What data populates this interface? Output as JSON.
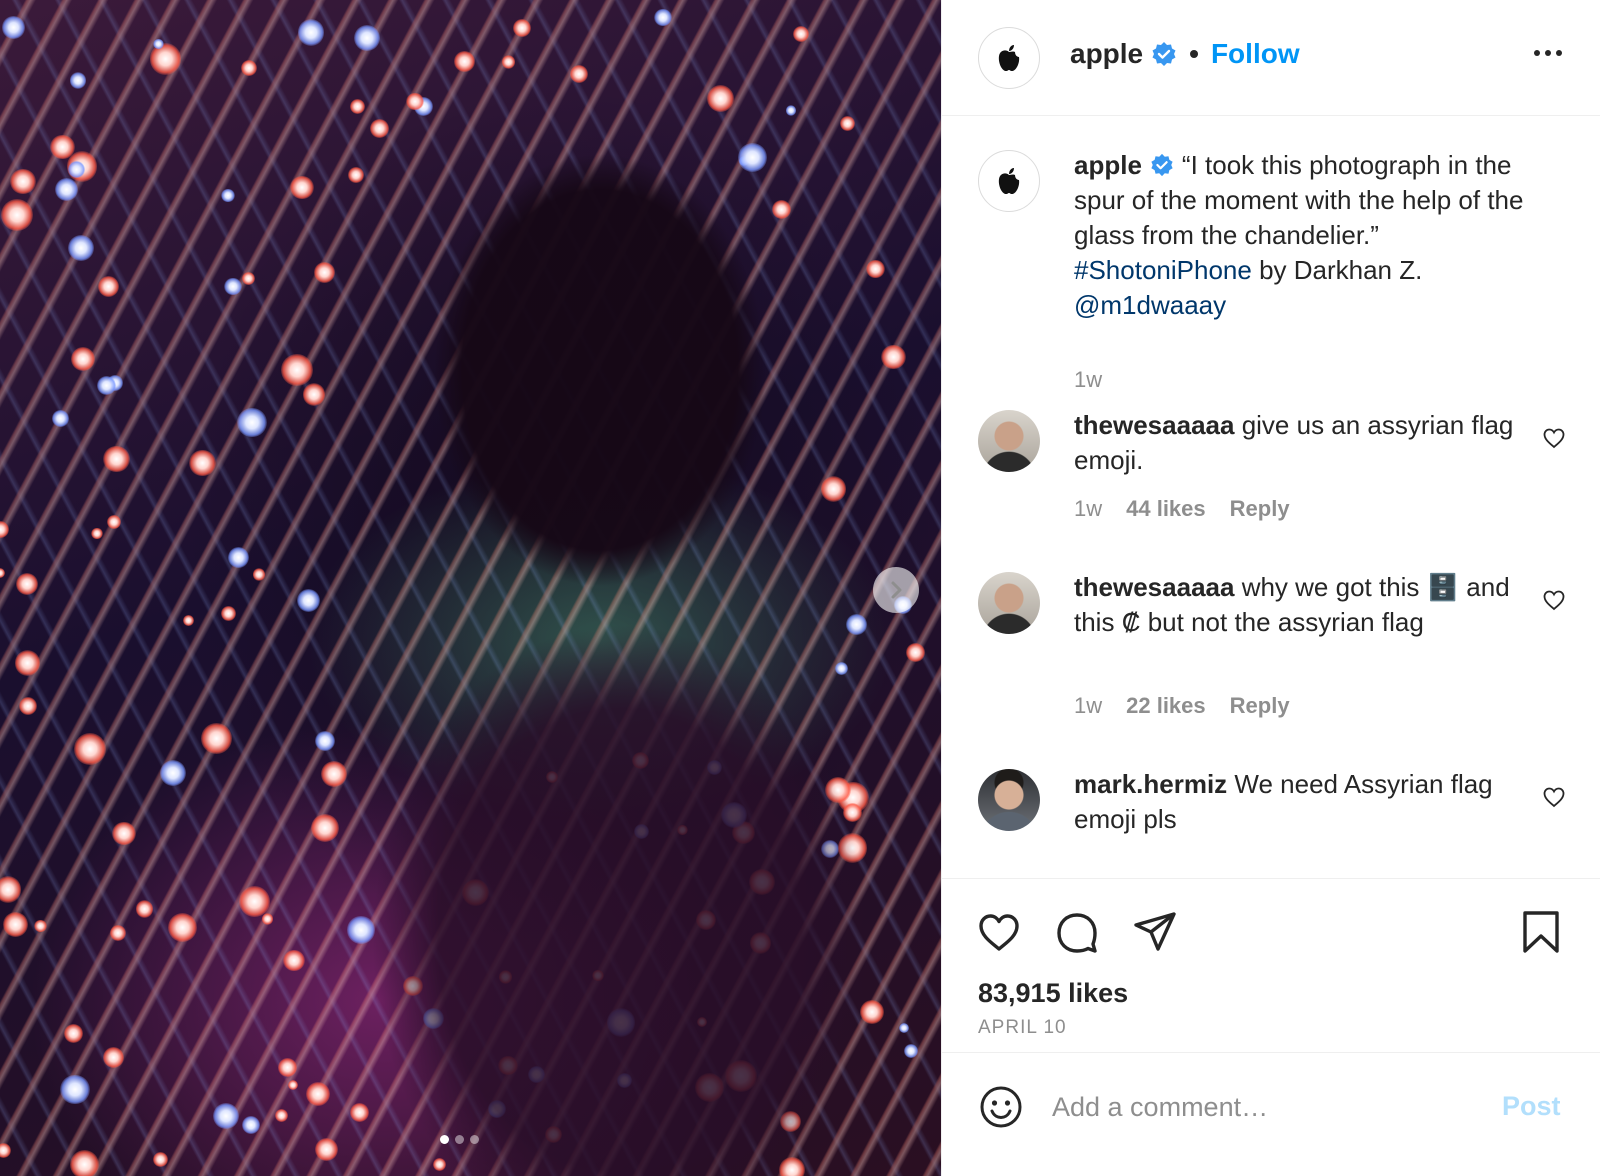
{
  "post": {
    "username": "apple",
    "follow_label": "Follow",
    "separator": "•",
    "carousel": {
      "current_slide": 1,
      "total_slides": 3
    }
  },
  "caption": {
    "username": "apple",
    "text_before_hashtag": "“I took this photograph in the spur of the moment with the help of the glass from the chandelier.”",
    "hashtag": "#ShotoniPhone",
    "text_by": "by Darkhan Z.",
    "mention": "@m1dwaaay",
    "time": "1w"
  },
  "comments": [
    {
      "username": "thewesaaaaa",
      "text": "give us an assyrian flag emoji.",
      "time": "1w",
      "likes": "44 likes",
      "reply": "Reply"
    },
    {
      "username": "thewesaaaaa",
      "text_part1": "why we got this",
      "emoji1": "🗄️",
      "text_part2": "and this",
      "emoji2": "₡",
      "text_part3": "but not the assyrian flag",
      "time": "1w",
      "likes": "22 likes",
      "reply": "Reply"
    },
    {
      "username": "mark.hermiz",
      "text": "We need Assyrian flag emoji pls"
    }
  ],
  "stats": {
    "likes": "83,915 likes",
    "date": "APRIL 10"
  },
  "add_comment": {
    "placeholder": "Add a comment…",
    "post_label": "Post"
  },
  "colors": {
    "accent": "#0095f6",
    "link": "#00376b",
    "muted": "#8e8e8e",
    "post_disabled": "#b2dffc"
  },
  "icons": [
    "apple-logo-icon",
    "verified-badge-icon",
    "more-options-icon",
    "chevron-right-icon",
    "heart-icon",
    "comment-icon",
    "share-icon",
    "bookmark-icon",
    "emoji-icon"
  ]
}
